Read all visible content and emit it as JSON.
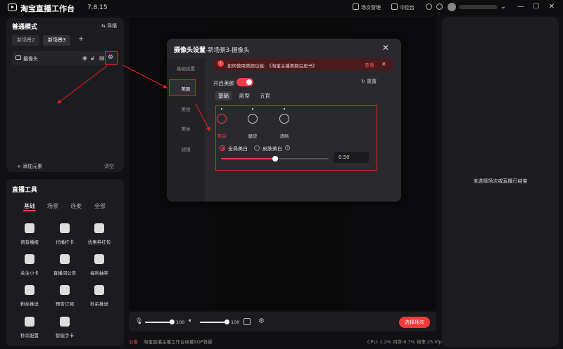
{
  "app": {
    "title": "淘宝直播工作台",
    "version": "7.8.15"
  },
  "topbar": {
    "links": [
      "场次管理",
      "中控台"
    ]
  },
  "scene_panel": {
    "title": "普通模式",
    "export_label": "导播",
    "tabs": [
      "新场景2",
      "新场景3"
    ],
    "add_tab": "+",
    "source_name": "摄像头",
    "add_element": "添加元素",
    "clear": "清空"
  },
  "tools_panel": {
    "title": "直播工具",
    "tabs": [
      "基础",
      "场景",
      "连麦",
      "全部"
    ],
    "items": [
      "语音播报",
      "代播打卡",
      "优惠券红包",
      "关注小卡",
      "直播间公告",
      "福利抽奖",
      "粉丝推送",
      "预告订阅",
      "秒杀推送",
      "秒杀配置",
      "智能手卡"
    ]
  },
  "bottom_bar": {
    "mic_volume": "100",
    "speaker_volume": "100",
    "start_button": "选择场次",
    "footer_notice_label": "公告",
    "footer_notice": "淘宝直播主播工作台绿幕SOP答疑",
    "status": "CPU: 1.2% 内存:6.7% 帧率:25.0fps"
  },
  "right_panel": {
    "message": "未选择场次或直播已结束"
  },
  "modal": {
    "title": "摄像头设置",
    "subtitle": "-新场景3-摄像头",
    "close": "✕",
    "side_items": [
      "基础设置",
      "美颜",
      "美妆",
      "美体",
      "滤镜"
    ],
    "notice": "如何使用美颜功能: 《淘宝主播美颜白皮书》",
    "notice_link": "查看",
    "reset": "重置",
    "enable_label": "开启美颜",
    "tabs": [
      "基础",
      "脸型",
      "五官"
    ],
    "effects": [
      "美白",
      "磨皮",
      "清晰"
    ],
    "radio_options": [
      "全局美白",
      "皮肤美白"
    ],
    "slider_value": "0.50",
    "slider_fraction": 0.5
  },
  "colors": {
    "accent": "#f03a4a",
    "highlight": "#e02020"
  }
}
